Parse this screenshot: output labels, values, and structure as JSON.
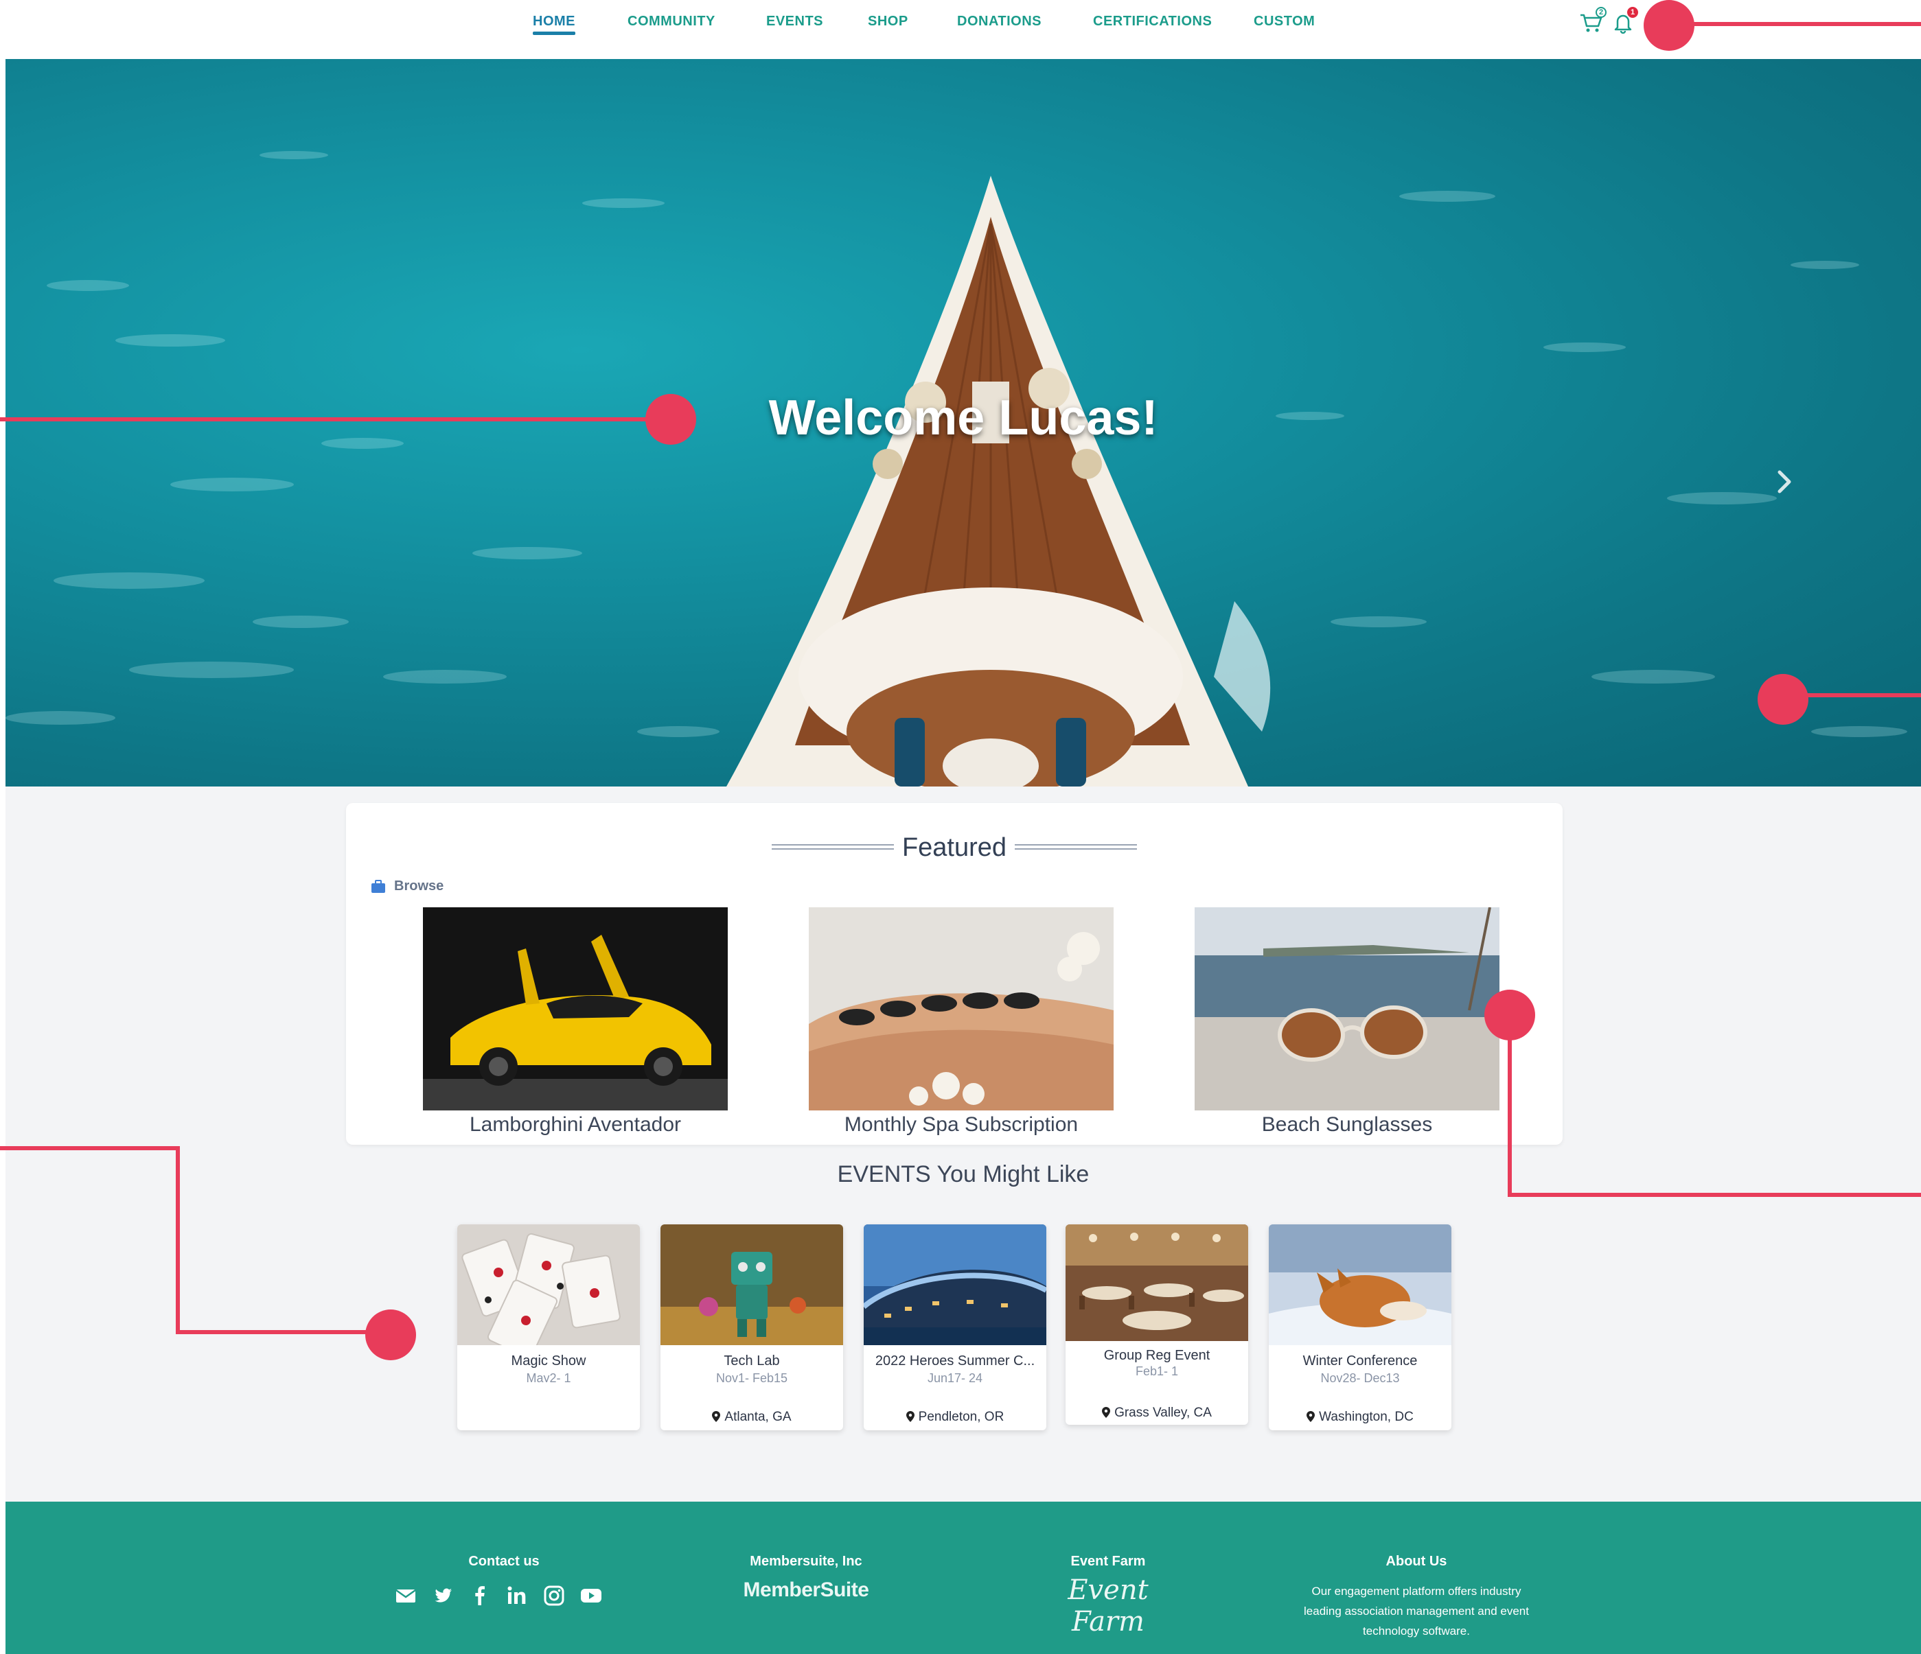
{
  "nav": {
    "items": [
      {
        "label": "HOME",
        "active": true
      },
      {
        "label": "COMMUNITY",
        "active": false
      },
      {
        "label": "EVENTS",
        "active": false
      },
      {
        "label": "SHOP",
        "active": false
      },
      {
        "label": "DONATIONS",
        "active": false
      },
      {
        "label": "CERTIFICATIONS",
        "active": false
      },
      {
        "label": "CUSTOM",
        "active": false
      }
    ],
    "cart_icon": "shopping-cart-icon",
    "cart_count": "2",
    "bell_icon": "bell-icon",
    "notification_count": "1"
  },
  "hero": {
    "title": "Welcome Lucas!",
    "next_icon": "chevron-right-icon"
  },
  "featured": {
    "title": "Featured",
    "browse_label": "Browse",
    "browse_icon": "briefcase-icon",
    "items": [
      {
        "label": "Lamborghini Aventador"
      },
      {
        "label": "Monthly Spa Subscription"
      },
      {
        "label": "Beach Sunglasses"
      }
    ]
  },
  "events": {
    "title": "EVENTS You Might Like",
    "items": [
      {
        "name": "Magic Show",
        "date": "May2- 1",
        "location": ""
      },
      {
        "name": "Tech Lab",
        "date": "Nov1- Feb15",
        "location": "Atlanta, GA"
      },
      {
        "name": "2022 Heroes Summer C...",
        "date": "Jun17- 24",
        "location": "Pendleton, OR"
      },
      {
        "name": "Group Reg Event",
        "date": "Feb1- 1",
        "location": "Grass Valley, CA"
      },
      {
        "name": "Winter Conference",
        "date": "Nov28- Dec13",
        "location": "Washington, DC"
      }
    ]
  },
  "footer": {
    "contact_title": "Contact us",
    "social_icons": [
      "envelope-icon",
      "twitter-icon",
      "facebook-icon",
      "linkedin-icon",
      "instagram-icon",
      "youtube-icon"
    ],
    "membersuite_title": "Membersuite, Inc",
    "membersuite_logo": "MemberSuite",
    "eventfarm_title": "Event Farm",
    "eventfarm_logo": "Event Farm",
    "about_title": "About Us",
    "about_text": "Our engagement platform offers industry leading association management and event technology software."
  },
  "colors": {
    "accent_teal": "#1f9b88",
    "nav_active": "#1a7fa8",
    "callout": "#e83c5a",
    "ocean": "#138f9f"
  }
}
